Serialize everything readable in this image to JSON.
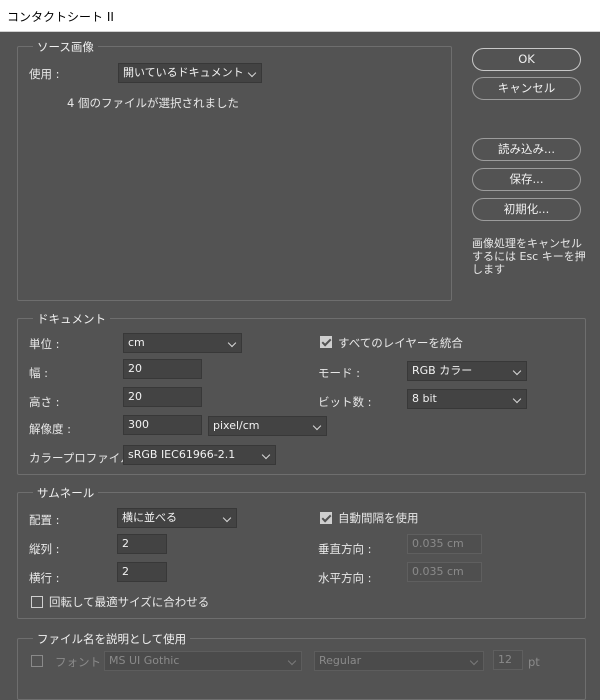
{
  "window": {
    "title": "コンタクトシート II"
  },
  "source": {
    "legend": "ソース画像",
    "use_label": "使用 :",
    "use_value": "開いているドキュメント",
    "status": "4 個のファイルが選択されました"
  },
  "buttons": {
    "ok": "OK",
    "cancel": "キャンセル",
    "load": "読み込み...",
    "save": "保存...",
    "reset": "初期化...",
    "hint_line1": "画像処理をキャンセル",
    "hint_line2": "するには Esc キーを押",
    "hint_line3": "します"
  },
  "document": {
    "legend": "ドキュメント",
    "unit_label": "単位 :",
    "unit_value": "cm",
    "width_label": "幅 :",
    "width_value": "20",
    "height_label": "高さ :",
    "height_value": "20",
    "resolution_label": "解像度 :",
    "resolution_value": "300",
    "resolution_unit": "pixel/cm",
    "profile_label": "カラープロファイル :",
    "profile_value": "sRGB IEC61966-2.1",
    "flatten_label": "すべてのレイヤーを統合",
    "flatten_checked": true,
    "mode_label": "モード :",
    "mode_value": "RGB カラー",
    "bitdepth_label": "ビット数 :",
    "bitdepth_value": "8 bit"
  },
  "thumbnails": {
    "legend": "サムネール",
    "place_label": "配置 :",
    "place_value": "横に並べる",
    "columns_label": "縦列 :",
    "columns_value": "2",
    "rows_label": "横行 :",
    "rows_value": "2",
    "autospacing_label": "自動間隔を使用",
    "autospacing_checked": true,
    "vertical_label": "垂直方向 :",
    "vertical_value": "0.035 cm",
    "horizontal_label": "水平方向 :",
    "horizontal_value": "0.035 cm",
    "rotate_label": "回転して最適サイズに合わせる",
    "rotate_checked": false
  },
  "caption": {
    "legend": "ファイル名を説明として使用",
    "font_label": "フォント :",
    "font_value": "MS UI Gothic",
    "style_value": "Regular",
    "size_value": "12",
    "size_unit": "pt"
  }
}
